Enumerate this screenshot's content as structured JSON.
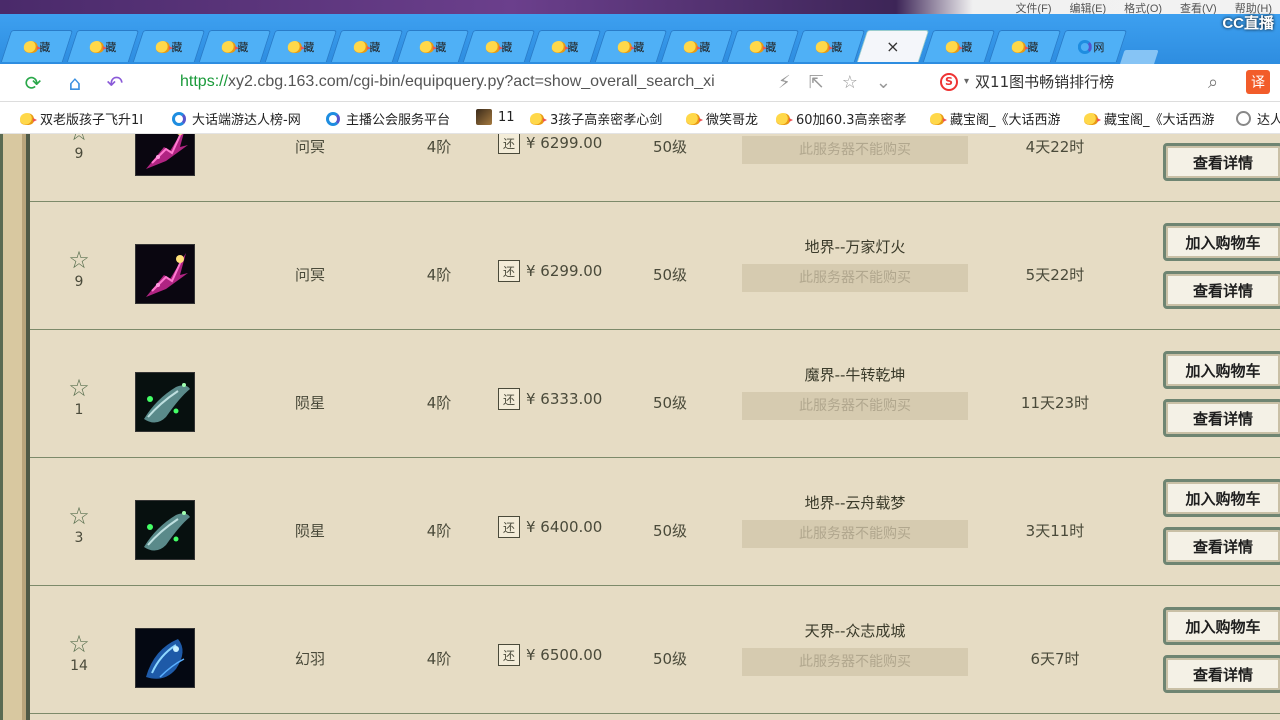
{
  "top_menu": [
    "文件(F)",
    "编辑(E)",
    "格式(O)",
    "查看(V)",
    "帮助(H)"
  ],
  "cc_logo": "CC直播",
  "tabs": {
    "generic_label": "藏",
    "count_before_active": 13,
    "count_after_active": 2,
    "last_label": "网",
    "active_close": "×"
  },
  "address": {
    "scheme": "https://",
    "rest": "xy2.cbg.163.com/cgi-bin/equipquery.py?act=show_overall_search_xi",
    "search_label": "双11图书畅销排行榜",
    "translate": "译"
  },
  "bookmarks": [
    {
      "label": "双老版孩子飞升1I",
      "icon": "chick"
    },
    {
      "label": "大话端游达人榜-网",
      "icon": "e"
    },
    {
      "label": "主播公会服务平台",
      "icon": "e"
    },
    {
      "label": "11",
      "icon": "img"
    },
    {
      "label": "3孩子高亲密孝心剑",
      "icon": "chick"
    },
    {
      "label": "微笑哥龙",
      "icon": "chick"
    },
    {
      "label": "60加60.3高亲密孝",
      "icon": "chick"
    },
    {
      "label": "藏宝阁_《大话西游",
      "icon": "chick"
    },
    {
      "label": "藏宝阁_《大话西游",
      "icon": "chick"
    },
    {
      "label": "达人",
      "icon": "globe"
    }
  ],
  "rows": [
    {
      "fav": "9",
      "name": "问冥",
      "tier": "4阶",
      "huan": "还",
      "price": "¥ 6299.00",
      "level": "50级",
      "server": "",
      "nobuy": "此服务器不能购买",
      "time": "4天22时",
      "cart": "加入购物车",
      "detail": "查看详情",
      "art": "pink"
    },
    {
      "fav": "9",
      "name": "问冥",
      "tier": "4阶",
      "huan": "还",
      "price": "¥ 6299.00",
      "level": "50级",
      "server": "地界--万家灯火",
      "nobuy": "此服务器不能购买",
      "time": "5天22时",
      "cart": "加入购物车",
      "detail": "查看详情",
      "art": "pink"
    },
    {
      "fav": "1",
      "name": "陨星",
      "tier": "4阶",
      "huan": "还",
      "price": "¥ 6333.00",
      "level": "50级",
      "server": "魔界--牛转乾坤",
      "nobuy": "此服务器不能购买",
      "time": "11天23时",
      "cart": "加入购物车",
      "detail": "查看详情",
      "art": "teal"
    },
    {
      "fav": "3",
      "name": "陨星",
      "tier": "4阶",
      "huan": "还",
      "price": "¥ 6400.00",
      "level": "50级",
      "server": "地界--云舟载梦",
      "nobuy": "此服务器不能购买",
      "time": "3天11时",
      "cart": "加入购物车",
      "detail": "查看详情",
      "art": "teal"
    },
    {
      "fav": "14",
      "name": "幻羽",
      "tier": "4阶",
      "huan": "还",
      "price": "¥ 6500.00",
      "level": "50级",
      "server": "天界--众志成城",
      "nobuy": "此服务器不能购买",
      "time": "6天7时",
      "cart": "加入购物车",
      "detail": "查看详情",
      "art": "blue"
    }
  ],
  "colors": {
    "page_bg": "#e6dcc4",
    "tab_bar": "#2e8de0",
    "url_scheme": "#1a9a3a",
    "button_border": "#6f8572"
  }
}
